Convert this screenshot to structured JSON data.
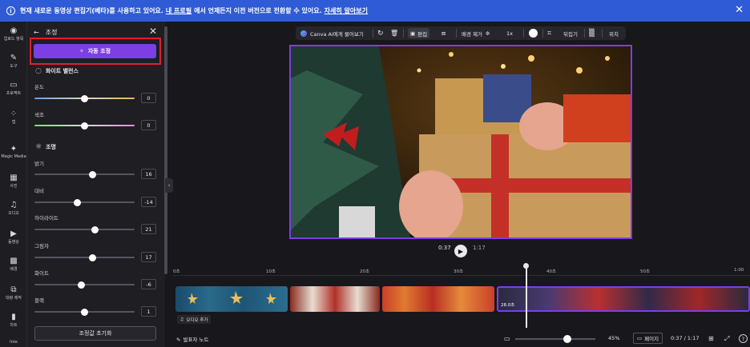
{
  "banner": {
    "info_icon": "i",
    "text_prefix": "현재 새로운 동영상 편집기(베타)를 사용하고 있어요.",
    "link1": "내 프로필",
    "text_mid": "에서 언제든지 이전 버전으로 전환할 수 있어요.",
    "link2": "자세히 알아보기",
    "close": "✕"
  },
  "rail": [
    {
      "icon": "◉",
      "label": "업로드 항목"
    },
    {
      "icon": "✎",
      "label": "도구"
    },
    {
      "icon": "▭",
      "label": "프로젝트"
    },
    {
      "icon": "⁘",
      "label": "앱"
    },
    {
      "icon": "✦",
      "label": "Magic Media"
    },
    {
      "icon": "▦",
      "label": "사진"
    },
    {
      "icon": "♫",
      "label": "오디오"
    },
    {
      "icon": "▶",
      "label": "동영상"
    },
    {
      "icon": "▩",
      "label": "배경"
    },
    {
      "icon": "⧉",
      "label": "대량 제작"
    },
    {
      "icon": "▮",
      "label": "차트"
    },
    {
      "icon": "",
      "label": "Inte"
    }
  ],
  "panel": {
    "back": "←",
    "title": "조정",
    "close": "✕",
    "auto_button": "자동 조정",
    "white_balance": "화이트 밸런스",
    "lighting": "조명",
    "reset": "조정값 초기화",
    "sliders": [
      {
        "label": "온도",
        "value": "0",
        "level": 0.5
      },
      {
        "label": "색조",
        "value": "0",
        "level": 0.5
      },
      {
        "label": "밝기",
        "value": "16",
        "level": 0.58
      },
      {
        "label": "대비",
        "value": "-14",
        "level": 0.43
      },
      {
        "label": "하이라이트",
        "value": "21",
        "level": 0.6
      },
      {
        "label": "그림자",
        "value": "17",
        "level": 0.58
      },
      {
        "label": "화이트",
        "value": "-6",
        "level": 0.47
      },
      {
        "label": "블랙",
        "value": "1",
        "level": 0.5
      }
    ]
  },
  "toolbar": {
    "ask": "Canva AI에게 물어보기",
    "edit": "편집",
    "bg_remove": "배경 제거",
    "speed": "1x",
    "flip": "뒤집기",
    "position": "위치"
  },
  "player": {
    "current": "0:37",
    "total": "1:17",
    "play": "▶"
  },
  "ruler": [
    "0초",
    "10초",
    "20초",
    "30초",
    "40초",
    "50초",
    "1:00"
  ],
  "clip_label": "28.0초",
  "audio_add": "오디오 추가",
  "bottom": {
    "notes": "발표자 노트",
    "zoom": "45%",
    "page": "페이지",
    "time": "0:37 / 1:17",
    "help": "?"
  },
  "colors": {
    "accent": "#7b3fe4",
    "banner": "#2f5bd6",
    "highlight": "#e0202a"
  }
}
